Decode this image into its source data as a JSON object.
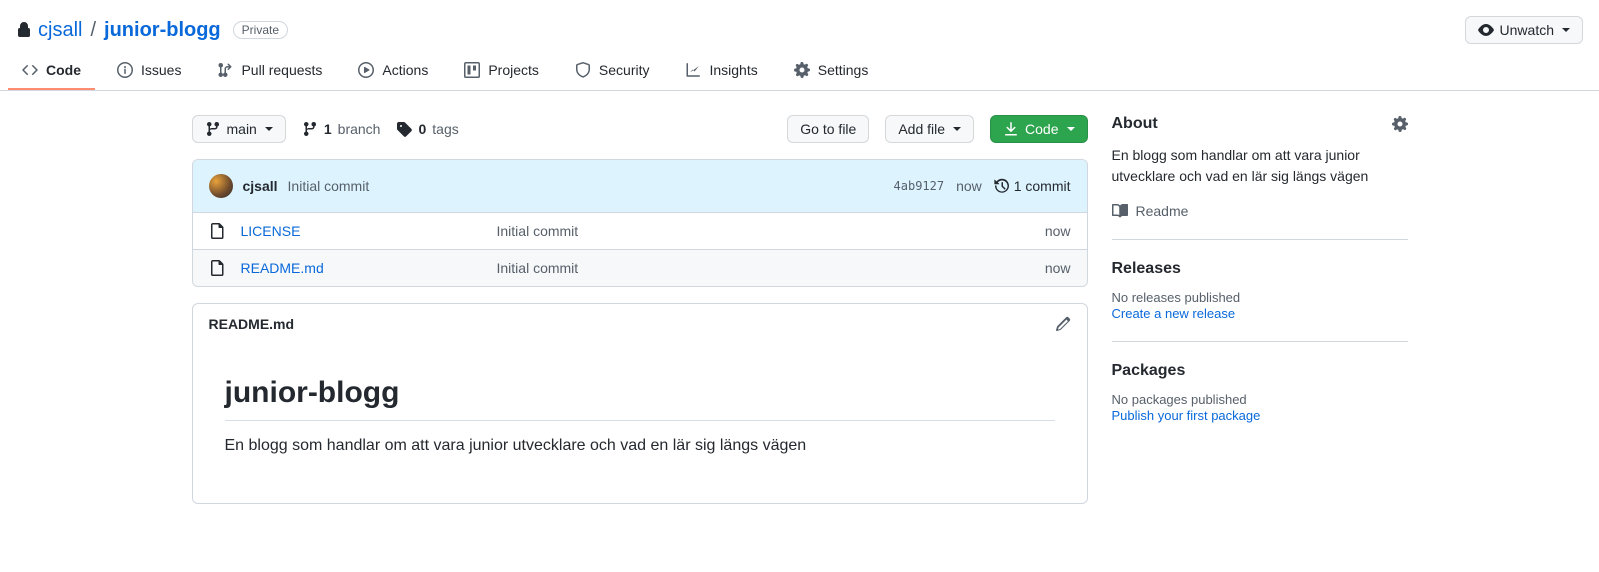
{
  "breadcrumb": {
    "owner": "cjsall",
    "sep": "/",
    "repo": "junior-blogg",
    "visibility": "Private"
  },
  "unwatch_label": "Unwatch",
  "tabs": {
    "code": "Code",
    "issues": "Issues",
    "pulls": "Pull requests",
    "actions": "Actions",
    "projects": "Projects",
    "security": "Security",
    "insights": "Insights",
    "settings": "Settings"
  },
  "toolbar": {
    "branch": "main",
    "branch_count": "1",
    "branch_label": "branch",
    "tag_count": "0",
    "tag_label": "tags",
    "goto_label": "Go to file",
    "addfile_label": "Add file",
    "code_label": "Code"
  },
  "commit": {
    "author": "cjsall",
    "message": "Initial commit",
    "sha": "4ab9127",
    "time": "now",
    "count": "1",
    "count_label": "commit"
  },
  "files": [
    {
      "name": "LICENSE",
      "message": "Initial commit",
      "time": "now"
    },
    {
      "name": "README.md",
      "message": "Initial commit",
      "time": "now"
    }
  ],
  "readme": {
    "filename": "README.md",
    "title": "junior-blogg",
    "body": "En blogg som handlar om att vara junior utvecklare och vad en lär sig längs vägen"
  },
  "about": {
    "heading": "About",
    "description": "En blogg som handlar om att vara junior utvecklare och vad en lär sig längs vägen",
    "readme_link": "Readme"
  },
  "releases": {
    "heading": "Releases",
    "empty": "No releases published",
    "cta": "Create a new release"
  },
  "packages": {
    "heading": "Packages",
    "empty": "No packages published",
    "cta": "Publish your first package"
  }
}
